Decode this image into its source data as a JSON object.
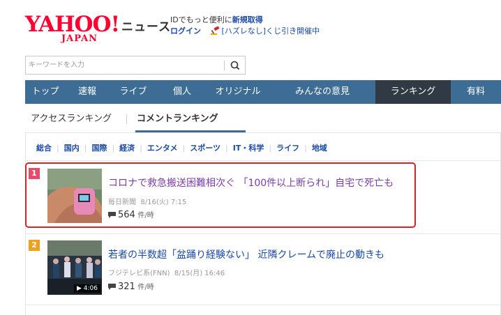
{
  "header": {
    "logo_main": "YAHOO!",
    "logo_sub": "JAPAN",
    "service_title": "ニュース",
    "promo_prefix": "IDでもっと便利に",
    "promo_signup": "新規取得",
    "login_label": "ログイン",
    "lottery_text": "[ハズレなし]くじ引き開催中"
  },
  "search": {
    "placeholder": "キーワードを入力",
    "button_icon": "search-icon"
  },
  "nav": {
    "items": [
      {
        "label": "トップ"
      },
      {
        "label": "速報"
      },
      {
        "label": "ライブ"
      },
      {
        "label": "個人"
      },
      {
        "label": "オリジナル"
      },
      {
        "label": "みんなの意見"
      },
      {
        "label": "ランキング"
      },
      {
        "label": "有料"
      }
    ],
    "active_index": 6
  },
  "subtabs": {
    "access": "アクセスランキング",
    "comment": "コメントランキング"
  },
  "categories": [
    "総合",
    "国内",
    "国際",
    "経済",
    "エンタメ",
    "スポーツ",
    "IT・科学",
    "ライフ",
    "地域"
  ],
  "articles": [
    {
      "rank": "1",
      "title": "コロナで救急搬送困難相次ぐ 「100件以上断られ」自宅で死亡も",
      "source": "毎日新聞",
      "date": "8/16(火) 7:15",
      "count": "564",
      "unit": "件/時"
    },
    {
      "rank": "2",
      "title": "若者の半数超「盆踊り経験ない」 近隣クレームで廃止の動きも",
      "source": "フジテレビ系(FNN)",
      "date": "8/15(月) 16:46",
      "count": "321",
      "unit": "件/時",
      "duration": "4:06"
    }
  ],
  "colors": {
    "brand_red": "#ff0033",
    "nav_bg": "#3d6d94",
    "nav_active": "#2f3a44",
    "title_purple": "#7b3ea8",
    "title_blue": "#1a4aa8",
    "rank1": "#e84a6a",
    "rank2": "#f0a020",
    "highlight": "#e02020"
  }
}
